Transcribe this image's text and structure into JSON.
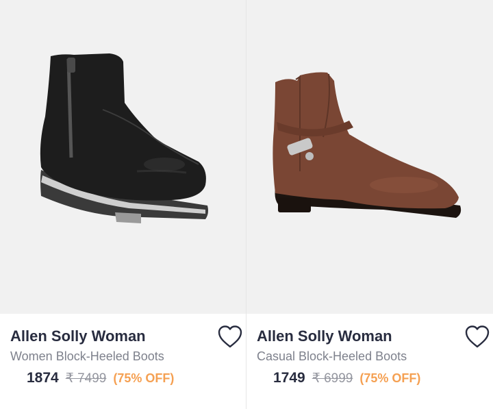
{
  "products": [
    {
      "brand": "Allen Solly Woman",
      "title": "Women Block-Heeled Boots",
      "price": "1874",
      "mrp": "₹ 7499",
      "discount": "(75% OFF)",
      "image": "black-wedge-ankle-boot"
    },
    {
      "brand": "Allen Solly Woman",
      "title": "Casual Block-Heeled Boots",
      "price": "1749",
      "mrp": "₹ 6999",
      "discount": "(75% OFF)",
      "image": "brown-buckle-ankle-boot"
    }
  ],
  "icons": {
    "wishlist": "heart-outline-icon"
  },
  "colors": {
    "brand_text": "#282c3f",
    "subtitle_text": "#7e818c",
    "mrp_text": "#94969f",
    "discount_text": "#f5a052",
    "image_bg": "#f1f1f1"
  }
}
